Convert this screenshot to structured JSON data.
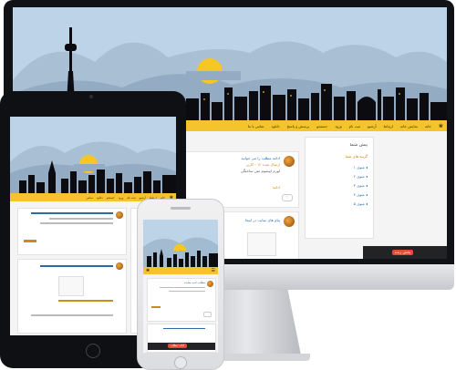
{
  "colors": {
    "sky": "#bcd3e8",
    "mountains": "#9fb7cc",
    "city": "#0c0c10",
    "sun": "#f6c627",
    "nav": "#f3c42b",
    "bezel": "#101114",
    "content": "#f4f4f4",
    "accent_blue": "#2a6aa8",
    "accent_red": "#e04b3a"
  },
  "desktop": {
    "nav_items": [
      "خانه",
      "نمایش خانه",
      "ارتباط",
      "آرشیو",
      "ثبت نام",
      "ورود",
      "جستجو",
      "پرسش و پاسخ",
      "دانلود",
      "تماس با ما"
    ],
    "sidebar": {
      "title": "پیش شما",
      "subtitle": "گزینه های شما",
      "links": [
        "منوی ۱",
        "منوی ۲",
        "منوی ۳",
        "منوی ۴",
        "منوی ۵"
      ]
    },
    "post1": {
      "title": "ادامه مطلب را می خوانید",
      "meta": "ارسال شده ۱۲ - کاربر",
      "body": "لورم ایپسوم متن ساختگی",
      "tag": "ادامه"
    },
    "post2": {
      "title": "پیام های سایت در اینجا"
    },
    "status_pill": "پخش زنده"
  },
  "tablet": {
    "nav_items": [
      "خانه",
      "ارتباط",
      "آرشیو",
      "ثبت نام",
      "ورود",
      "جستجو",
      "دانلود",
      "تماس"
    ]
  },
  "phone": {
    "post_title": "مطلب جدید سایت",
    "bottom_text": "ادامه مطلب"
  }
}
